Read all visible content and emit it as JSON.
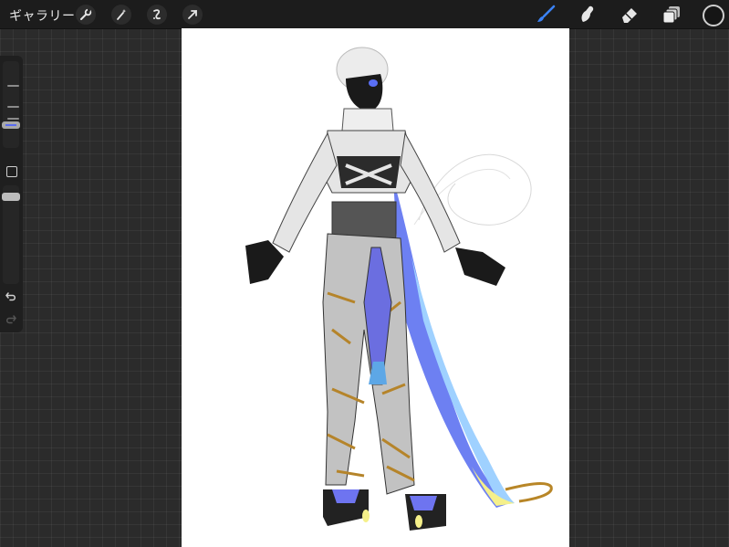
{
  "toolbar": {
    "gallery_label": "ギャラリー",
    "left_tools": [
      "wrench-icon",
      "magic-wand-icon",
      "selection-icon",
      "transform-arrow-icon"
    ],
    "right_tools": [
      "brush-icon",
      "smudge-icon",
      "eraser-icon",
      "layers-icon"
    ],
    "active_tool": "brush",
    "accent_color": "#3b82f6",
    "current_color": "#151515"
  },
  "sidebar": {
    "controls": [
      "brush-size-slider",
      "modify-button",
      "opacity-slider",
      "undo-button",
      "redo-button"
    ]
  },
  "colors": {
    "workspace": "#2b2b2b",
    "toolbar_bg": "#1c1c1c",
    "canvas": "#ffffff"
  }
}
